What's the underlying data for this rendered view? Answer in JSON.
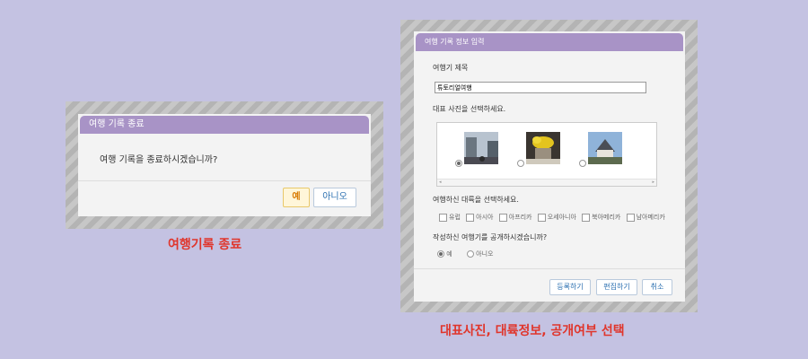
{
  "dialog1": {
    "title": "여행 기록 종료",
    "message": "여행 기록을 종료하시겠습니까?",
    "yes_label": "예",
    "no_label": "아니오",
    "caption": "여행기록 종료"
  },
  "dialog2": {
    "title": "여행 기록 정보 입력",
    "title_label": "여행기 제목",
    "title_value": "튜토리얼여행",
    "photo_label": "대표 사진을 선택하세요.",
    "continent_label": "여행하신 대륙을 선택하세요.",
    "continents": [
      "유럽",
      "아시아",
      "아프리카",
      "오세아니아",
      "북아메리카",
      "남아메리카"
    ],
    "public_label": "작성하신 여행기를 공개하시겠습니까?",
    "public_yes": "예",
    "public_no": "아니오",
    "register_label": "등록하기",
    "edit_label": "편집하기",
    "cancel_label": "취소",
    "caption": "대표사진, 대륙정보, 공개여부 선택"
  },
  "colors": {
    "title_bar": "#a893c6",
    "caption": "#e0352b",
    "background": "#c4c2e2"
  }
}
